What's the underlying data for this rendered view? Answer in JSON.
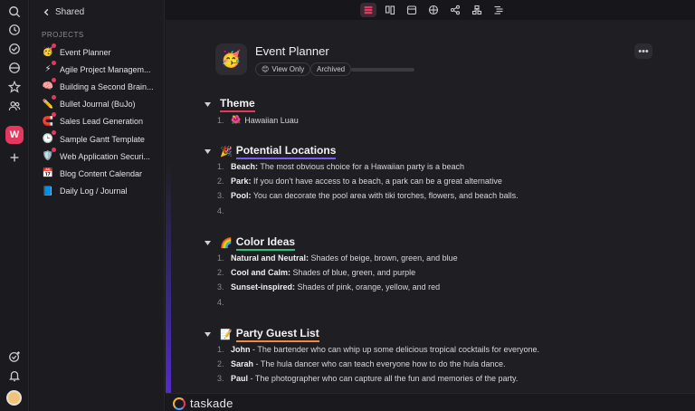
{
  "sidebar": {
    "back_label": "Shared",
    "section_label": "PROJECTS",
    "projects": [
      {
        "emoji": "🥳",
        "label": "Event Planner"
      },
      {
        "emoji": "⚡",
        "label": "Agile Project Managem..."
      },
      {
        "emoji": "🧠",
        "label": "Building a Second Brain..."
      },
      {
        "emoji": "✏️",
        "label": "Bullet Journal (BuJo)"
      },
      {
        "emoji": "🧲",
        "label": "Sales Lead Generation"
      },
      {
        "emoji": "🕒",
        "label": "Sample Gantt Template"
      },
      {
        "emoji": "🛡️",
        "label": "Web Application Securi..."
      },
      {
        "emoji": "📅",
        "label": "Blog Content Calendar"
      },
      {
        "emoji": "📘",
        "label": "Daily Log / Journal"
      }
    ]
  },
  "rail": {
    "workspace_initial": "W"
  },
  "document": {
    "icon": "🥳",
    "title": "Event Planner",
    "view_only_emoji": "😊",
    "view_only_label": "View Only",
    "archived_label": "Archived",
    "more_label": "•••"
  },
  "sections": {
    "theme": {
      "title": "Theme",
      "items": [
        {
          "num": "1.",
          "emoji": "🌺",
          "text": "Hawaiian Luau"
        }
      ]
    },
    "locations": {
      "emoji": "🎉",
      "title": "Potential Locations",
      "items": [
        {
          "num": "1.",
          "bold": "Beach:",
          "text": " The most obvious choice for a Hawaiian party is a beach"
        },
        {
          "num": "2.",
          "bold": "Park:",
          "text": " If you don't have access to a beach, a park can be a great alternative"
        },
        {
          "num": "3.",
          "bold": "Pool:",
          "text": " You can decorate the pool area with tiki torches, flowers, and beach balls."
        },
        {
          "num": "4.",
          "bold": "",
          "text": ""
        }
      ]
    },
    "colors": {
      "emoji": "🌈",
      "title": "Color Ideas",
      "items": [
        {
          "num": "1.",
          "bold": "Natural and Neutral:",
          "text": " Shades of beige, brown, green, and blue"
        },
        {
          "num": "2.",
          "bold": "Cool and Calm:",
          "text": " Shades of blue, green, and purple"
        },
        {
          "num": "3.",
          "bold": "Sunset-inspired:",
          "text": " Shades of pink, orange, yellow, and red"
        },
        {
          "num": "4.",
          "bold": "",
          "text": ""
        }
      ]
    },
    "guests": {
      "emoji": "📝",
      "title": "Party Guest List",
      "items": [
        {
          "num": "1.",
          "bold": "John",
          "text": " - The bartender who can whip up some delicious tropical cocktails for everyone."
        },
        {
          "num": "2.",
          "bold": "Sarah",
          "text": " - The hula dancer who can teach everyone how to do the hula dance."
        },
        {
          "num": "3.",
          "bold": "Paul",
          "text": " - The photographer who can capture all the fun and memories of the party."
        }
      ]
    }
  },
  "footer": {
    "brand": "taskade"
  },
  "colors": {
    "accent": "#e6375f",
    "purple": "#7b5cf0",
    "green": "#30c27a",
    "orange": "#f08a3a"
  }
}
